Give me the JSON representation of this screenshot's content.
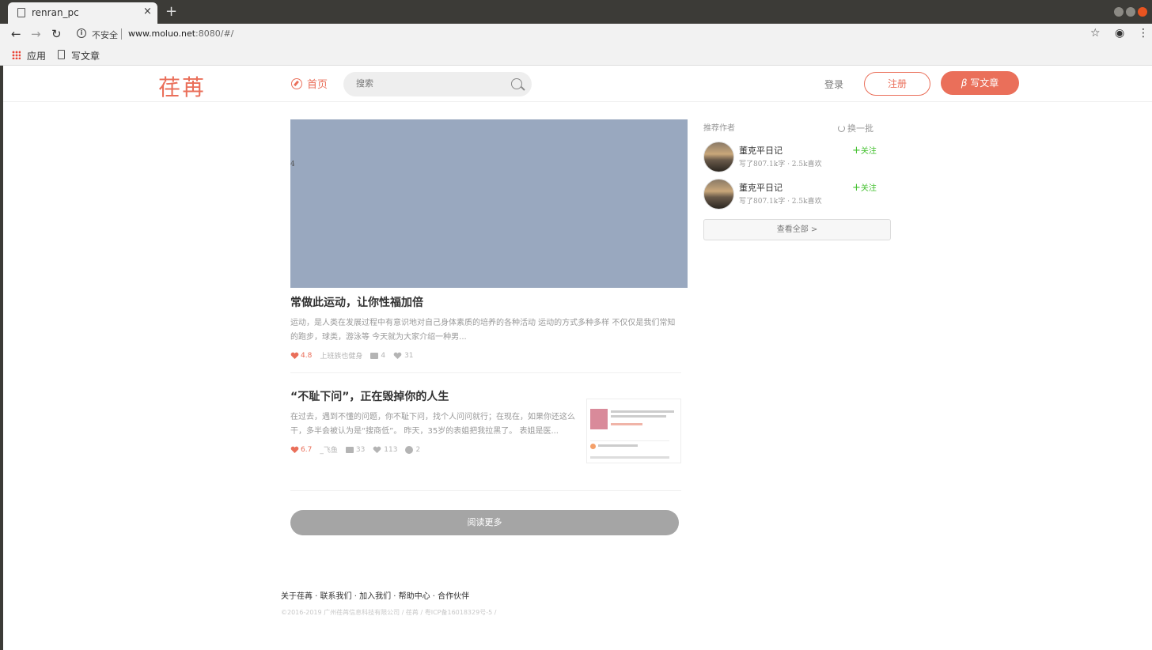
{
  "browser": {
    "tab_title": "renran_pc",
    "tab_close": "×",
    "new_tab": "+",
    "insecure_label": "不安全",
    "url_host": "www.moluo.net",
    "url_rest": ":8080/#/",
    "bookmarks": [
      "应用",
      "写文章"
    ]
  },
  "header": {
    "logo": "荏苒",
    "home": "首页",
    "search_placeholder": "搜索",
    "login": "登录",
    "register": "注册",
    "write": "写文章",
    "write_icon": "β",
    "accent": "#ea6f5a"
  },
  "banner": {
    "index": "4",
    "color": "#99a8bf"
  },
  "articles": [
    {
      "title": "常做此运动，让你性福加倍",
      "abstract": "运动，是人类在发展过程中有意识地对自己身体素质的培养的各种活动 运动的方式多种多样 不仅仅是我们常知的跑步，球类，游泳等 今天就为大家介绍一种男...",
      "score": "4.8",
      "author": "上班族也健身",
      "comments": "4",
      "likes": "31"
    },
    {
      "title": "“不耻下问”，正在毁掉你的人生",
      "abstract": "在过去，遇到不懂的问题，你不耻下问，找个人问问就行；在现在，如果你还这么干，多半会被认为是“搜商低”。 昨天，35岁的表姐把我拉黑了。 表姐是医...",
      "score": "6.7",
      "author": "_飞鱼",
      "comments": "33",
      "likes": "113",
      "rewards": "2"
    }
  ],
  "read_more": "阅读更多",
  "sidebar": {
    "title": "推荐作者",
    "refresh": "换一批",
    "authors": [
      {
        "name": "董克平日记",
        "info": "写了807.1k字 · 2.5k喜欢",
        "follow": "关注"
      },
      {
        "name": "董克平日记",
        "info": "写了807.1k字 · 2.5k喜欢",
        "follow": "关注"
      }
    ],
    "follow_plus": "+",
    "see_all": "查看全部 >",
    "follow_color": "#42c02e"
  },
  "footer": {
    "links": "关于荏苒 · 联系我们 · 加入我们 · 帮助中心 · 合作伙伴",
    "copyright": "©2016-2019 广州荏苒信息科技有限公司 / 荏苒 / 粤ICP备16018329号-5 /"
  }
}
